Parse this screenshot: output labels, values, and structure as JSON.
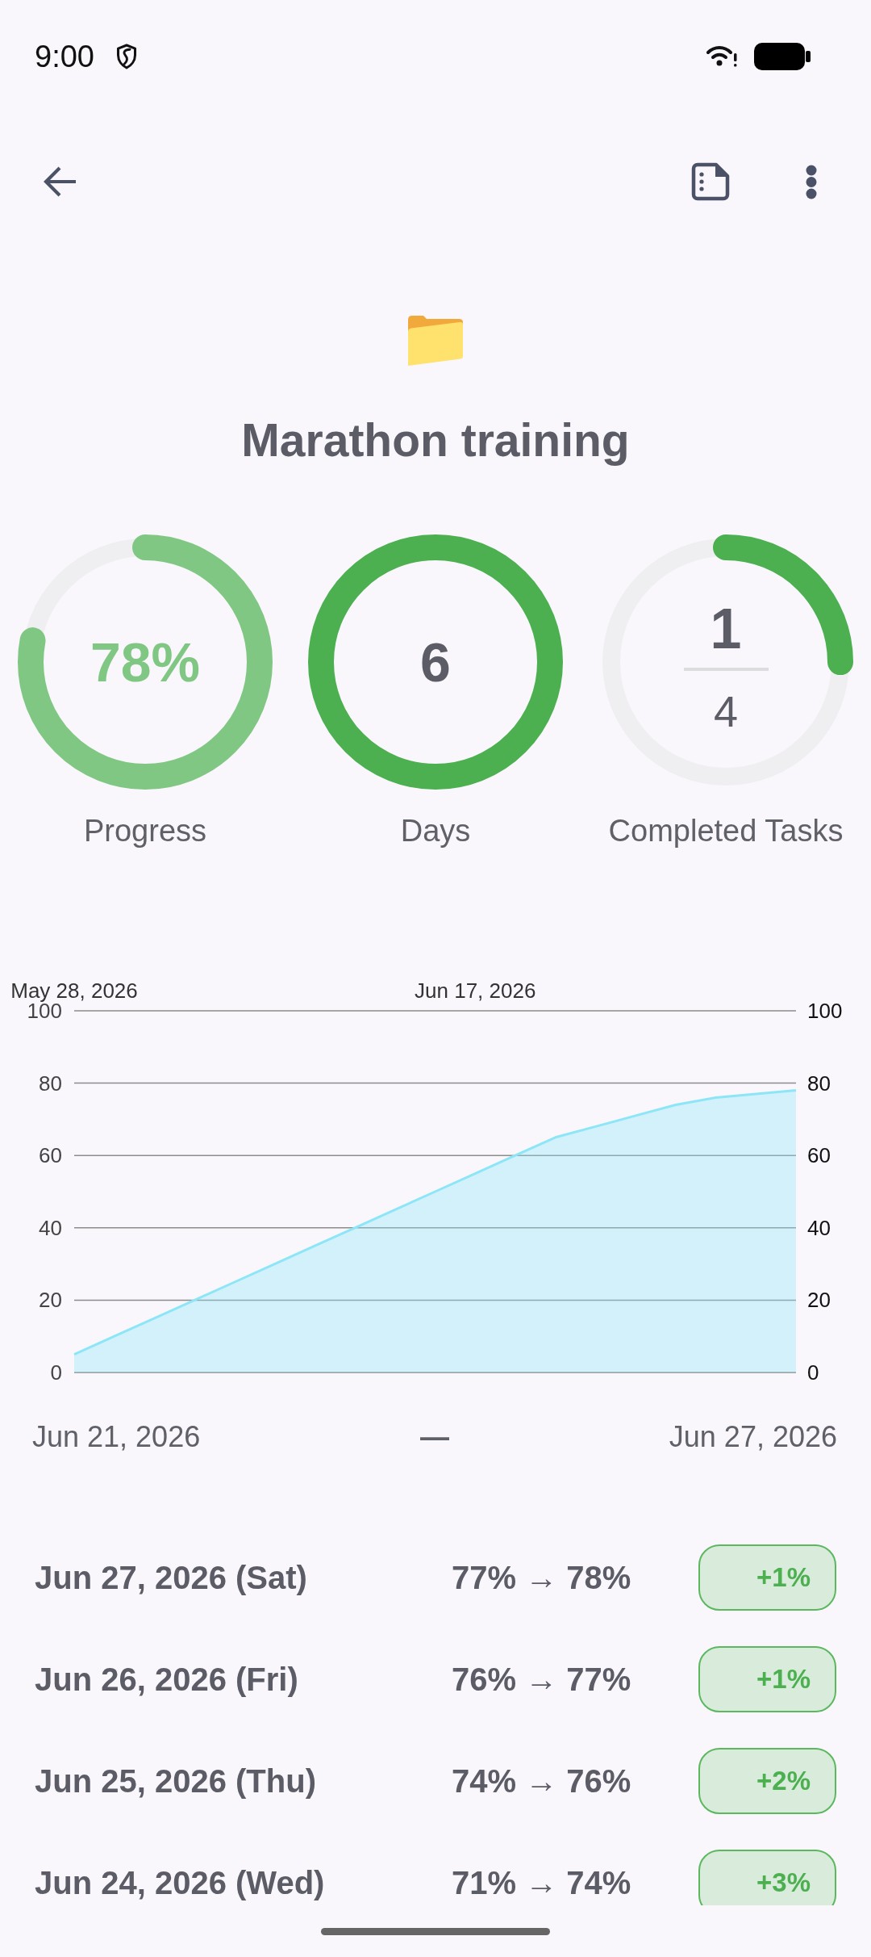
{
  "status_bar": {
    "time": "9:00"
  },
  "project": {
    "title": "Marathon training"
  },
  "stats": [
    {
      "kind": "percent",
      "value": "78%",
      "label": "Progress",
      "level": 0.78,
      "color": "#81c784"
    },
    {
      "kind": "count",
      "value": "6",
      "label": "Days",
      "level": 1,
      "color": "#4caf50"
    },
    {
      "kind": "fraction",
      "numerator": "1",
      "denominator": "4",
      "label": "Completed Tasks",
      "level": 0.25,
      "color": "#4caf50"
    }
  ],
  "progress_chart": {
    "chart_data": {
      "type": "area",
      "categories": [
        "May 28, 2026",
        null,
        null,
        null,
        null,
        null,
        null,
        null,
        null,
        null,
        "Jun 17, 2026",
        null,
        null,
        null,
        null,
        null,
        null,
        null,
        null
      ],
      "series": [
        {
          "color": "#8de6f7",
          "values": [
            5,
            10,
            15,
            20,
            25,
            30,
            35,
            40,
            45,
            50,
            55,
            60,
            65,
            68,
            71,
            74,
            76,
            77,
            78
          ]
        }
      ],
      "ylim": [
        0,
        100
      ],
      "y2lim": [
        0,
        100
      ],
      "yticks": [
        0,
        20,
        40,
        60,
        80,
        100
      ],
      "y2ticks": [
        0,
        20,
        40,
        60,
        80,
        100
      ],
      "grid": true
    }
  },
  "date_range": {
    "start": "Jun 21, 2026",
    "separator": "—",
    "end": "Jun 27, 2026"
  },
  "history": [
    {
      "date": "Jun 27, 2026 (Sat)",
      "percent_range": "77% → 78%",
      "change": "+1%"
    },
    {
      "date": "Jun 26, 2026 (Fri)",
      "percent_range": "76% → 77%",
      "change": "+1%"
    },
    {
      "date": "Jun 25, 2026 (Thu)",
      "percent_range": "74% → 76%",
      "change": "+2%"
    },
    {
      "date": "Jun 24, 2026 (Wed)",
      "percent_range": "71% → 74%",
      "change": "+3%"
    }
  ]
}
